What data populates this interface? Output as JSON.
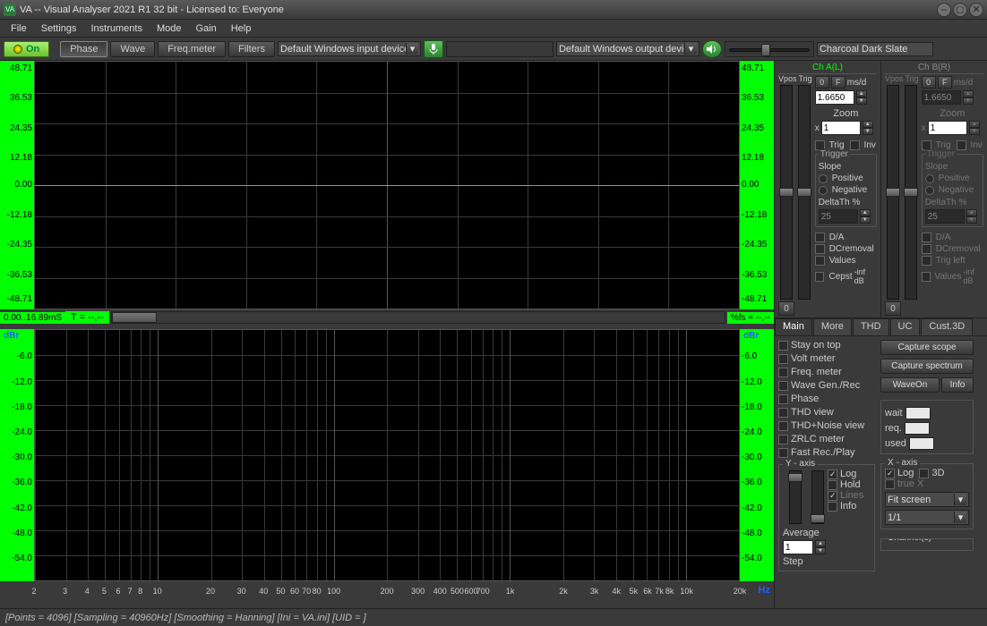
{
  "titlebar": {
    "icon_text": "VA",
    "text": "VA -- Visual Analyser 2021 R1 32 bit - Licensed to: Everyone"
  },
  "menu": [
    "File",
    "Settings",
    "Instruments",
    "Mode",
    "Gain",
    "Help"
  ],
  "toolbar": {
    "on": "On",
    "buttons": [
      "Phase",
      "Wave",
      "Freq.meter",
      "Filters"
    ],
    "input_device": "Default Windows input device",
    "output_device": "Default Windows output device",
    "theme": "Charcoal Dark Slate"
  },
  "scope": {
    "left_ticks": [
      "48.71",
      "36.53",
      "24.35",
      "12.18",
      "0.00",
      "-12.18",
      "-24.35",
      "-36.53",
      "-48.71"
    ],
    "right_ticks": [
      "48.71",
      "36.53",
      "24.35",
      "12.18",
      "0.00",
      "-12.18",
      "-24.35",
      "-36.53",
      "-48.71"
    ],
    "status_left": "0.00..16.89mS",
    "status_t": "T = --,--",
    "status_right": "%fs = --,--"
  },
  "spectrum": {
    "unit": "dBr",
    "left_ticks": [
      "-6.0",
      "-12.0",
      "-18.0",
      "-24.0",
      "-30.0",
      "-36.0",
      "-42.0",
      "-48.0",
      "-54.0"
    ],
    "right_ticks": [
      "-6.0",
      "-12.0",
      "-18.0",
      "-24.0",
      "-30.0",
      "-36.0",
      "-42.0",
      "-48.0",
      "-54.0"
    ],
    "x_ticks": [
      "2",
      "3",
      "4",
      "5",
      "6",
      "7",
      "8",
      "10",
      "20",
      "30",
      "40",
      "50",
      "60",
      "70",
      "80",
      "100",
      "200",
      "300",
      "400",
      "500",
      "600",
      "700",
      "1k",
      "2k",
      "3k",
      "4k",
      "5k",
      "6k",
      "7k",
      "8k",
      "10k",
      "20k"
    ],
    "hz": "Hz"
  },
  "channels": {
    "a": {
      "title": "Ch A(L)",
      "vpos": "Vpos",
      "trig": "Trig",
      "zero": "0",
      "f": "F",
      "msd": "ms/d",
      "msd_val": "1.6650",
      "zoom": "Zoom",
      "x": "x",
      "zoom_val": "1",
      "trig_chk": "Trig",
      "inv_chk": "Inv",
      "trigger": "Trigger",
      "slope": "Slope",
      "pos": "Positive",
      "neg": "Negative",
      "delta": "DeltaTh %",
      "delta_val": "25",
      "da": "D/A",
      "dcr": "DCremoval",
      "values": "Values",
      "cepst": "Cepst",
      "reset": "0",
      "inf": "-inf dB"
    },
    "b": {
      "title": "Ch B(R)",
      "vpos": "Vpos",
      "trig": "Trig",
      "zero": "0",
      "f": "F",
      "msd": "ms/d",
      "msd_val": "1.6650",
      "zoom": "Zoom",
      "x": "x",
      "zoom_val": "1",
      "trig_chk": "Trig",
      "inv_chk": "Inv",
      "trigger": "Trigger",
      "slope": "Slope",
      "pos": "Positive",
      "neg": "Negative",
      "delta": "DeltaTh %",
      "delta_val": "25",
      "da": "D/A",
      "dcr": "DCremoval",
      "trigleft": "Trig left",
      "values": "Values",
      "reset": "0",
      "inf": "-inf dB"
    }
  },
  "tabs": [
    "Main",
    "More",
    "THD",
    "UC",
    "Cust.3D"
  ],
  "main_tab": {
    "checks": [
      "Stay on top",
      "Volt meter",
      "Freq. meter",
      "Wave Gen./Rec",
      "Phase",
      "THD view",
      "THD+Noise view",
      "ZRLC meter",
      "Fast Rec./Play"
    ],
    "capture_scope": "Capture scope",
    "capture_spectrum": "Capture spectrum",
    "waveon": "WaveOn",
    "info": "Info",
    "wait": "wait",
    "req": "req.",
    "used": "used",
    "yaxis": "Y - axis",
    "xaxis": "X - axis",
    "log": "Log",
    "hold": "Hold",
    "lines": "Lines",
    "info_chk": "Info",
    "average": "Average",
    "avg_val": "1",
    "step": "Step",
    "threed": "3D",
    "truex": "true X",
    "fitscreen": "Fit screen",
    "ratio": "1/1",
    "channels": "Channel(s)"
  },
  "statusbar": "[Points = 4096]   [Sampling = 40960Hz]   [Smoothing = Hanning]   [Ini = VA.ini]   [UID = ]",
  "chart_data": [
    {
      "type": "line",
      "name": "oscilloscope",
      "xlabel": "ms",
      "ylabel": "",
      "ylim": [
        -48.71,
        48.71
      ],
      "xrange_ms": [
        0.0,
        16.89
      ],
      "series": [
        {
          "name": "Ch A",
          "values_note": "flat zero line",
          "values": [
            0,
            0,
            0,
            0,
            0,
            0,
            0,
            0,
            0,
            0
          ]
        }
      ]
    },
    {
      "type": "line",
      "name": "spectrum",
      "xlabel": "Hz",
      "ylabel": "dBr",
      "xscale": "log",
      "xlim": [
        2,
        20000
      ],
      "ylim": [
        -54.0,
        -6.0
      ],
      "series": [
        {
          "name": "Ch A",
          "values_note": "no signal displayed",
          "values": []
        }
      ]
    }
  ]
}
